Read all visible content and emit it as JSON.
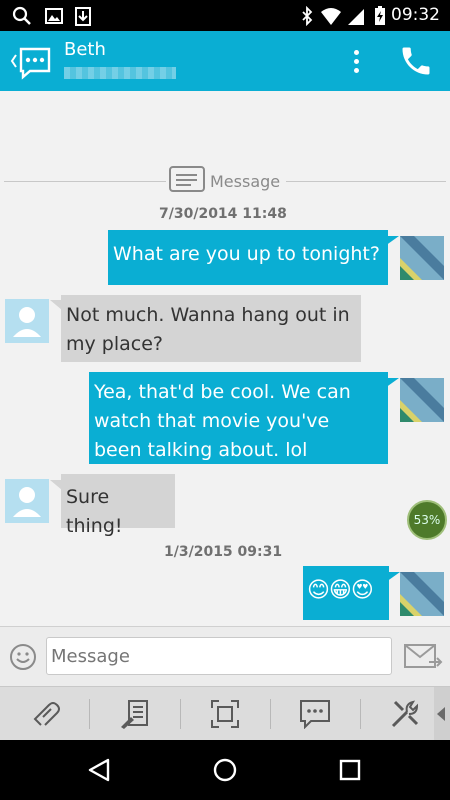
{
  "status_bar": {
    "time": "09:32",
    "icons": [
      "search-icon",
      "gallery-icon",
      "download-icon",
      "bluetooth-icon",
      "wifi-icon",
      "signal-icon",
      "battery-charging-icon"
    ]
  },
  "app_bar": {
    "contact_name": "Beth",
    "back_icon": "back-chevron-icon",
    "app_icon": "chat-bubble-icon",
    "menu_icon": "overflow-menu-icon",
    "call_icon": "phone-icon",
    "accent_color": "#0aaed3"
  },
  "thread": {
    "divider_label": "Message",
    "timestamps": [
      "7/30/2014 11:48",
      "1/3/2015 09:31"
    ],
    "messages": [
      {
        "direction": "out",
        "text": "What are you up to tonight?"
      },
      {
        "direction": "in",
        "text": "Not much. Wanna hang out in my place?"
      },
      {
        "direction": "out",
        "text": "Yea, that'd be cool. We can watch that movie you've been talking about. lol"
      },
      {
        "direction": "in",
        "text": "Sure thing!"
      },
      {
        "direction": "out",
        "text": "😊😁😍"
      }
    ],
    "progress_badge": "53%"
  },
  "compose": {
    "placeholder": "Message",
    "emoji_icon": "smiley-icon",
    "send_icon": "send-envelope-icon"
  },
  "toolbar": {
    "items": [
      "attach-icon",
      "template-icon",
      "screenshot-icon",
      "quick-text-icon",
      "settings-tools-icon"
    ],
    "expand_icon": "expand-left-icon"
  },
  "nav_bar": {
    "items": [
      "back-icon",
      "home-icon",
      "recents-icon"
    ]
  }
}
